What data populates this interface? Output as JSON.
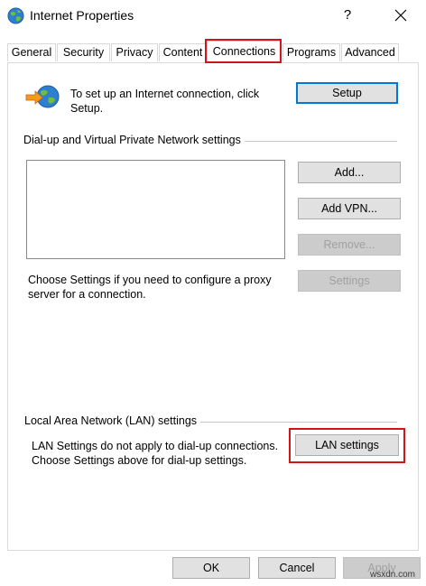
{
  "window": {
    "title": "Internet Properties",
    "help": "?"
  },
  "tabs": [
    {
      "label": "General"
    },
    {
      "label": "Security"
    },
    {
      "label": "Privacy"
    },
    {
      "label": "Content"
    },
    {
      "label": "Connections",
      "active": true
    },
    {
      "label": "Programs"
    },
    {
      "label": "Advanced"
    }
  ],
  "setup": {
    "text": "To set up an Internet connection, click Setup.",
    "button": "Setup"
  },
  "dialup": {
    "group_label": "Dial-up and Virtual Private Network settings",
    "add_button": "Add...",
    "add_vpn_button": "Add VPN...",
    "remove_button": "Remove...",
    "proxy_text": "Choose Settings if you need to configure a proxy server for a connection.",
    "settings_button": "Settings"
  },
  "lan": {
    "group_label": "Local Area Network (LAN) settings",
    "text": "LAN Settings do not apply to dial-up connections. Choose Settings above for dial-up settings.",
    "button": "LAN settings"
  },
  "footer": {
    "ok": "OK",
    "cancel": "Cancel",
    "apply": "Apply"
  },
  "watermark": "wsxdn.com",
  "colors": {
    "highlight_red": "#d3141c",
    "default_button_border": "#0078d7"
  }
}
